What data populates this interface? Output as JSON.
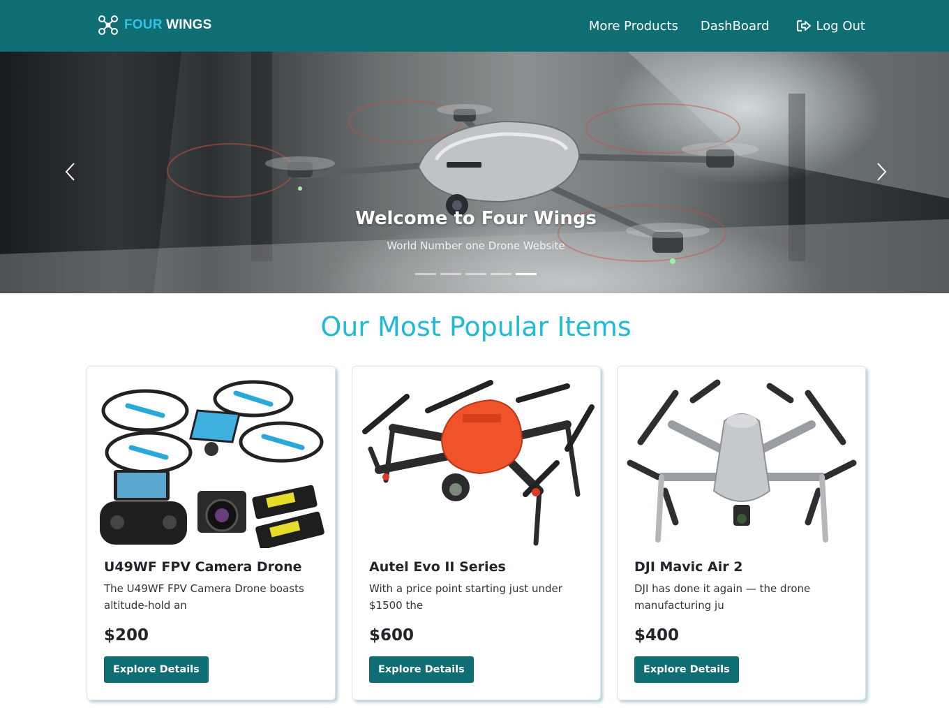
{
  "navbar": {
    "brand": {
      "part1": "FOUR",
      "part2": "WINGS",
      "logo_icon": "drone-icon"
    },
    "links": [
      {
        "label": "More Products"
      },
      {
        "label": "DashBoard"
      },
      {
        "label": "Log Out",
        "icon": "sign-out-icon"
      }
    ],
    "colors": {
      "background": "#0e6e74",
      "brand_accent": "#2ec4e6"
    }
  },
  "carousel": {
    "title": "Welcome to Four Wings",
    "subtitle": "World Number one Drone Website",
    "slide_count": 5,
    "active_index": 4,
    "prev_icon": "chevron-left-icon",
    "next_icon": "chevron-right-icon"
  },
  "section": {
    "title": "Our Most Popular Items",
    "title_color": "#1fbad6"
  },
  "products": [
    {
      "name": "U49WF FPV Camera Drone",
      "description": "The U49WF FPV Camera Drone boasts altitude-hold an",
      "price": "$200",
      "button": "Explore Details"
    },
    {
      "name": "Autel Evo II Series",
      "description": "With a price point starting just under $1500 the",
      "price": "$600",
      "button": "Explore Details"
    },
    {
      "name": "DJI Mavic Air 2",
      "description": "DJI has done it again — the drone manufacturing ju",
      "price": "$400",
      "button": "Explore Details"
    }
  ]
}
